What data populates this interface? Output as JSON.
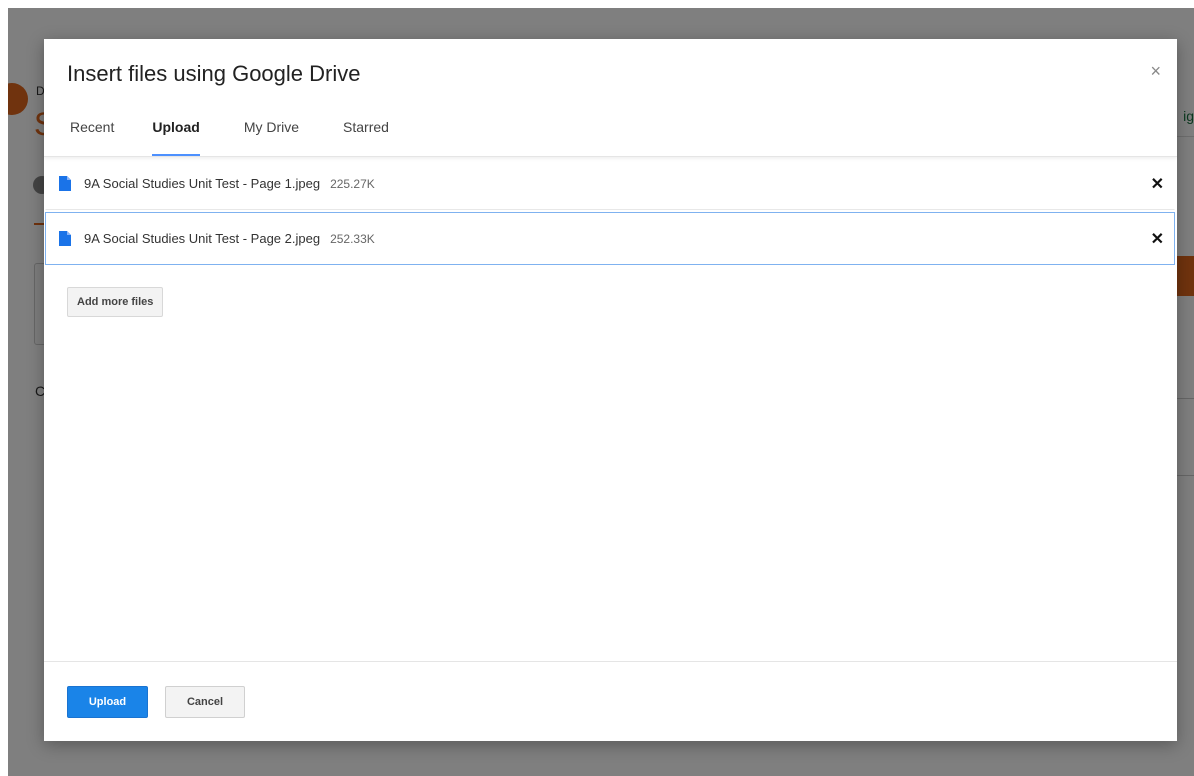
{
  "background": {
    "letter_d": "D",
    "letter_s": "S",
    "letter_c": "C",
    "right_text": "ig"
  },
  "dialog": {
    "title": "Insert files using Google Drive",
    "close_symbol": "×",
    "tabs": [
      {
        "label": "Recent",
        "active": false
      },
      {
        "label": "Upload",
        "active": true
      },
      {
        "label": "My Drive",
        "active": false
      },
      {
        "label": "Starred",
        "active": false
      }
    ],
    "files": [
      {
        "name": "9A Social Studies Unit Test - Page 1.jpeg",
        "size": "225.27K",
        "icon": "file-document-icon"
      },
      {
        "name": "9A Social Studies Unit Test - Page 2.jpeg",
        "size": "252.33K",
        "icon": "file-document-icon"
      }
    ],
    "remove_symbol": "✕",
    "add_more_label": "Add more files",
    "upload_label": "Upload",
    "cancel_label": "Cancel"
  },
  "colors": {
    "accent_blue": "#1a84e8",
    "tab_underline": "#4d90fe",
    "file_icon": "#1a73e8",
    "brand_orange": "#e0661c"
  }
}
